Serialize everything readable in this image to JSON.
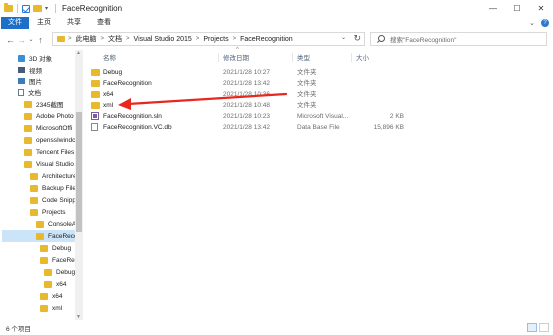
{
  "window": {
    "title": "FaceRecognition",
    "min_glyph": "—",
    "max_glyph": "☐",
    "close_glyph": "✕",
    "qa_dropdown": "▾"
  },
  "ribbon": {
    "tabs": [
      "文件",
      "主页",
      "共享",
      "查看"
    ],
    "expand_glyph": "⌄",
    "help_glyph": "?"
  },
  "nav_buttons": {
    "back": "←",
    "forward": "→",
    "recent": "⌄",
    "up": "↑"
  },
  "address": {
    "crumbs": [
      "此电脑",
      "文档",
      "Visual Studio 2015",
      "Projects",
      "FaceRecognition"
    ],
    "separator": ">",
    "dropdown_glyph": "⌄",
    "refresh_glyph": "↻"
  },
  "search": {
    "placeholder": "搜索\"FaceRecognition\""
  },
  "sidebar": {
    "scroll_up": "▲",
    "scroll_down": "▼",
    "items": [
      {
        "label": "3D 对象",
        "icon": "3d-objects-icon"
      },
      {
        "label": "视频",
        "icon": "video-icon"
      },
      {
        "label": "图片",
        "icon": "pictures-icon"
      },
      {
        "label": "文档",
        "icon": "documents-icon"
      },
      {
        "label": "2345截图",
        "icon": "folder-icon"
      },
      {
        "label": "Adobe Photo",
        "icon": "folder-icon"
      },
      {
        "label": "MicrosoftOffi",
        "icon": "folder-icon"
      },
      {
        "label": "openssIwindc",
        "icon": "folder-icon"
      },
      {
        "label": "Tencent Files",
        "icon": "folder-icon"
      },
      {
        "label": "Visual Studio",
        "icon": "folder-icon"
      },
      {
        "label": "Architecture",
        "icon": "folder-icon"
      },
      {
        "label": "Backup Files",
        "icon": "folder-icon"
      },
      {
        "label": "Code Snippe",
        "icon": "folder-icon"
      },
      {
        "label": "Projects",
        "icon": "folder-icon"
      },
      {
        "label": "ConsoleAp",
        "icon": "folder-icon"
      },
      {
        "label": "FaceRecog",
        "icon": "folder-icon",
        "selected": true
      },
      {
        "label": "Debug",
        "icon": "folder-icon"
      },
      {
        "label": "FaceReco",
        "icon": "folder-icon"
      },
      {
        "label": "Debug",
        "icon": "folder-icon"
      },
      {
        "label": "x64",
        "icon": "folder-icon"
      },
      {
        "label": "x64",
        "icon": "folder-icon"
      },
      {
        "label": "xml",
        "icon": "folder-icon"
      }
    ]
  },
  "columns": {
    "name": "名称",
    "date": "修改日期",
    "type": "类型",
    "size": "大小",
    "sort_glyph": "^"
  },
  "files": [
    {
      "name": "Debug",
      "date": "2021/1/28 10:27",
      "type": "文件夹",
      "size": "",
      "icon": "folder-icon"
    },
    {
      "name": "FaceRecognition",
      "date": "2021/1/28 13:42",
      "type": "文件夹",
      "size": "",
      "icon": "folder-icon"
    },
    {
      "name": "x64",
      "date": "2021/1/28 10:36",
      "type": "文件夹",
      "size": "",
      "icon": "folder-icon"
    },
    {
      "name": "xml",
      "date": "2021/1/28 10:48",
      "type": "文件夹",
      "size": "",
      "icon": "folder-icon"
    },
    {
      "name": "FaceRecognition.sln",
      "date": "2021/1/28 10:23",
      "type": "Microsoft Visual...",
      "size": "2 KB",
      "icon": "solution-file-icon"
    },
    {
      "name": "FaceRecognition.VC.db",
      "date": "2021/1/28 13:42",
      "type": "Data Base File",
      "size": "15,896 KB",
      "icon": "database-file-icon"
    }
  ],
  "status": {
    "count": "6 个项目"
  },
  "annotation": {
    "color": "#e8281e"
  }
}
